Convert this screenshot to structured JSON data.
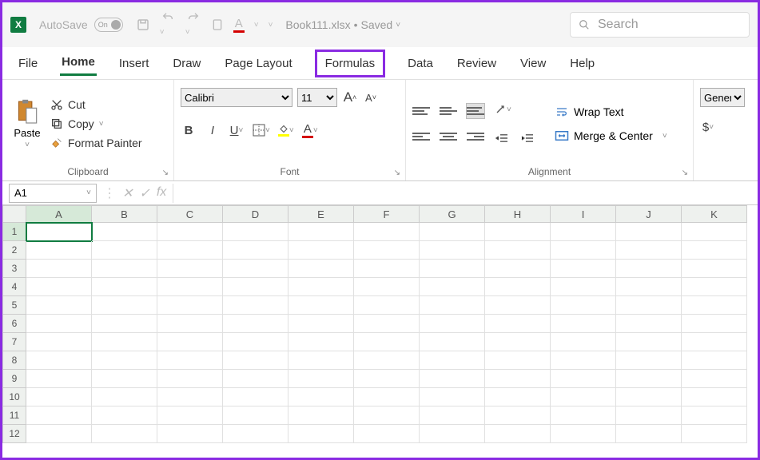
{
  "title": {
    "autosave": "AutoSave",
    "toggle": "On",
    "filename": "Book111.xlsx",
    "status": "Saved"
  },
  "search": {
    "placeholder": "Search"
  },
  "tabs": [
    "File",
    "Home",
    "Insert",
    "Draw",
    "Page Layout",
    "Formulas",
    "Data",
    "Review",
    "View",
    "Help"
  ],
  "active_tab": "Home",
  "highlighted_tab": "Formulas",
  "clipboard": {
    "paste": "Paste",
    "cut": "Cut",
    "copy": "Copy",
    "painter": "Format Painter",
    "label": "Clipboard"
  },
  "font": {
    "name": "Calibri",
    "size": "11",
    "label": "Font"
  },
  "alignment": {
    "wrap": "Wrap Text",
    "merge": "Merge & Center",
    "label": "Alignment"
  },
  "number": {
    "format": "General",
    "currency": "$"
  },
  "namebox": "A1",
  "columns": [
    "A",
    "B",
    "C",
    "D",
    "E",
    "F",
    "G",
    "H",
    "I",
    "J",
    "K"
  ],
  "rows": [
    "1",
    "2",
    "3",
    "4",
    "5",
    "6",
    "7",
    "8",
    "9",
    "10",
    "11",
    "12"
  ],
  "selected_cell": "A1"
}
